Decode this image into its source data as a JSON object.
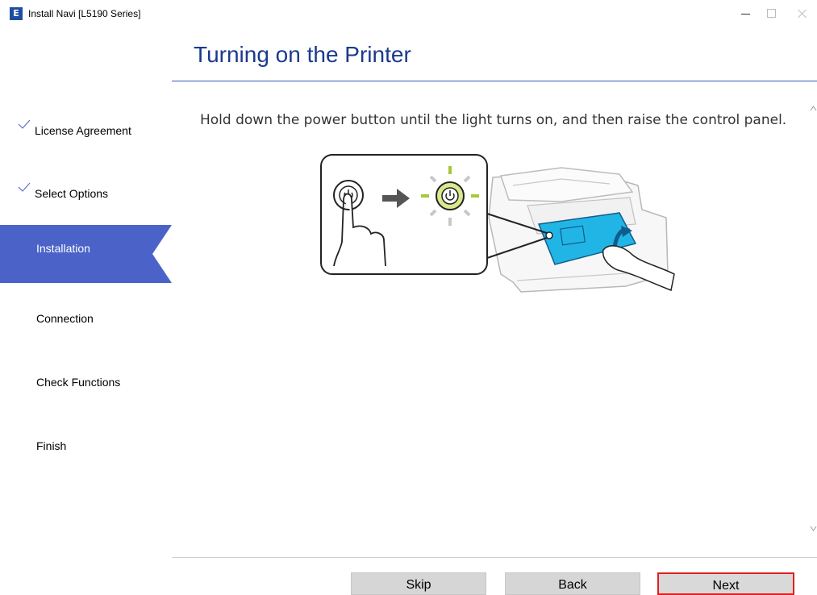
{
  "window": {
    "title": "Install Navi [L5190 Series]",
    "app_icon_letter": "E"
  },
  "page": {
    "title": "Turning on the Printer",
    "instruction": "Hold down the power button until the light turns on, and then raise the control panel."
  },
  "sidebar": {
    "steps": [
      {
        "label": "License Agreement",
        "state": "done"
      },
      {
        "label": "Select Options",
        "state": "done"
      },
      {
        "label": "Installation",
        "state": "active"
      },
      {
        "label": "Connection",
        "state": "pending"
      },
      {
        "label": "Check Functions",
        "state": "pending"
      },
      {
        "label": "Finish",
        "state": "pending"
      }
    ]
  },
  "footer": {
    "skip_label": "Skip",
    "back_label": "Back",
    "next_label": "Next"
  },
  "colors": {
    "accent": "#4b63c9",
    "title": "#1a3a8c",
    "panel_cyan": "#21b5e6",
    "light_green": "#a5c83a",
    "highlight_border": "#e01f1f"
  }
}
